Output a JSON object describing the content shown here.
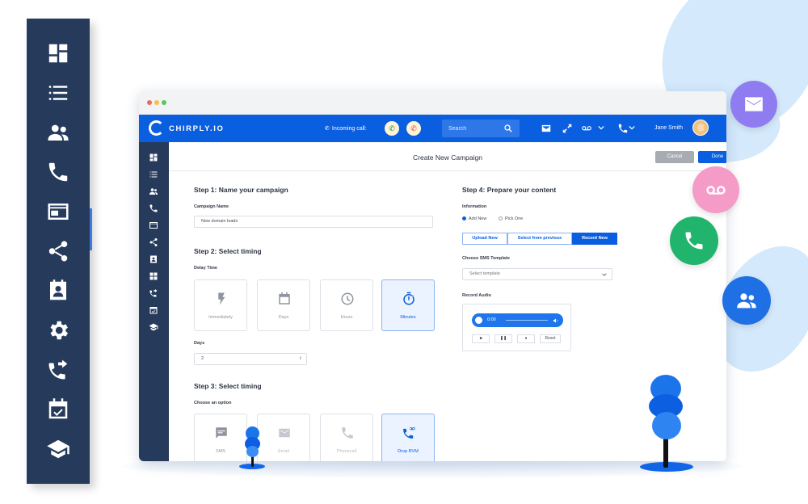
{
  "app": {
    "logo_text": "CHIRPLY.IO",
    "incoming_label": "Incoming call:",
    "search_placeholder": "Search",
    "user_name": "Jane Smith"
  },
  "colors": {
    "brand_blue": "#0a5ee0",
    "sidebar_navy": "#263a5b",
    "mail_purple": "#8f7cf0",
    "voicemail_pink": "#f59bc7",
    "call_green": "#21b46c",
    "contacts_blue": "#1f6fe5",
    "leaf_light_blue": "#d4e9fb"
  },
  "big_sidebar": {
    "icons": [
      "dashboard-icon",
      "list-icon",
      "contacts-icon",
      "phone-icon",
      "browser-icon",
      "share-icon",
      "contact-card-icon",
      "settings-icon",
      "call-forward-icon",
      "calendar-check-icon",
      "school-icon"
    ]
  },
  "page": {
    "title": "Create New Campaign",
    "cancel_label": "Cancel",
    "done_label": "Done"
  },
  "step1": {
    "title": "Step 1: Name your campaign",
    "field_label": "Campaign Name",
    "field_value": "New domain leads"
  },
  "step2": {
    "title": "Step 2: Select timing",
    "delay_label": "Delay Time",
    "options": [
      "Immediately",
      "Days",
      "Hours",
      "Minutes"
    ],
    "selected": "Minutes",
    "days_label": "Days",
    "days_value": "2"
  },
  "step3": {
    "title": "Step 3: Select timing",
    "choose_label": "Choose an option",
    "options": [
      "SMS",
      "Email",
      "Phonecall",
      "Drop RVM"
    ],
    "selected": "Drop RVM"
  },
  "step4": {
    "title": "Step 4: Prepare your content",
    "info_label": "Information",
    "radio_add": "Add New",
    "radio_pick": "Pick One",
    "radio_selected": "Add New",
    "segments": [
      "Upload New",
      "Select from previous",
      "Record New"
    ],
    "segment_selected": "Record New",
    "sms_label": "Choose SMS Template",
    "sms_placeholder": "Select template",
    "record_label": "Record Audio",
    "player_time": "0:00",
    "audio_buttons": [
      "■",
      "❚❚",
      "●",
      "Reset"
    ]
  },
  "floating_actions": [
    "mail-icon",
    "voicemail-icon",
    "phone-icon",
    "contacts-icon"
  ]
}
